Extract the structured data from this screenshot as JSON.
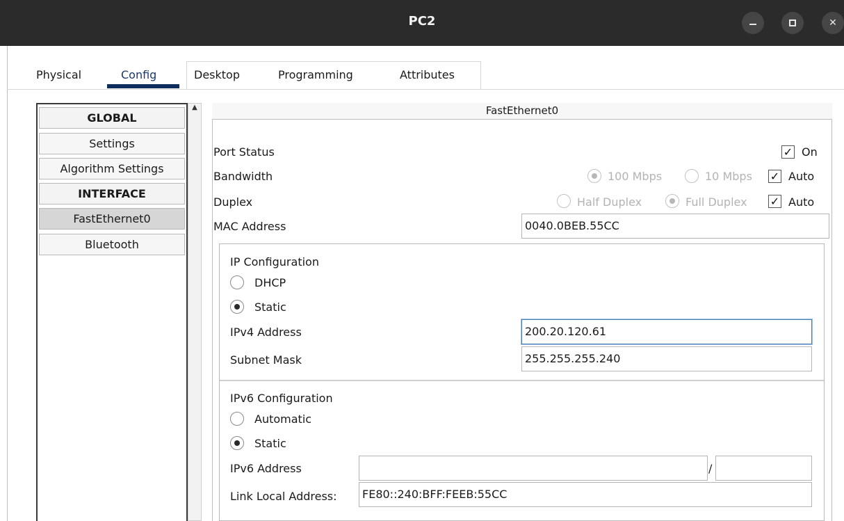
{
  "window": {
    "title": "PC2",
    "controls": {
      "minimize_icon": "minimize-icon",
      "maximize_icon": "maximize-icon",
      "close_icon": "close-icon"
    }
  },
  "tabs": [
    {
      "label": "Physical"
    },
    {
      "label": "Config",
      "active": true
    },
    {
      "label": "Desktop"
    },
    {
      "label": "Programming"
    },
    {
      "label": "Attributes"
    }
  ],
  "sidebar": {
    "items": [
      {
        "label": "GLOBAL",
        "type": "header"
      },
      {
        "label": "Settings"
      },
      {
        "label": "Algorithm Settings"
      },
      {
        "label": "INTERFACE",
        "type": "header"
      },
      {
        "label": "FastEthernet0",
        "selected": true
      },
      {
        "label": "Bluetooth"
      }
    ]
  },
  "panel": {
    "header": "FastEthernet0",
    "port_status": {
      "label": "Port Status",
      "on_label": "On",
      "on_checked": true
    },
    "bandwidth": {
      "label": "Bandwidth",
      "opt1": "100 Mbps",
      "opt2": "10 Mbps",
      "auto_label": "Auto",
      "auto_checked": true,
      "selected": "100 Mbps"
    },
    "duplex": {
      "label": "Duplex",
      "opt1": "Half Duplex",
      "opt2": "Full Duplex",
      "auto_label": "Auto",
      "auto_checked": true,
      "selected": "Full Duplex"
    },
    "mac": {
      "label": "MAC Address",
      "value": "0040.0BEB.55CC"
    },
    "ip_config": {
      "title": "IP Configuration",
      "dhcp_label": "DHCP",
      "static_label": "Static",
      "selected": "Static",
      "ipv4_label": "IPv4 Address",
      "ipv4_value": "200.20.120.61",
      "mask_label": "Subnet Mask",
      "mask_value": "255.255.255.240"
    },
    "ipv6_config": {
      "title": "IPv6 Configuration",
      "auto_label": "Automatic",
      "static_label": "Static",
      "selected": "Static",
      "ipv6_label": "IPv6 Address",
      "ipv6_value": "",
      "prefix_sep": "/",
      "prefix_value": "",
      "link_local_label": "Link Local Address:",
      "link_local_value": "FE80::240:BFF:FEEB:55CC"
    }
  },
  "colors": {
    "titlebar": "#2b2b2b",
    "tab_underline": "#0f2d5c",
    "focus": "#4a7fb3"
  }
}
